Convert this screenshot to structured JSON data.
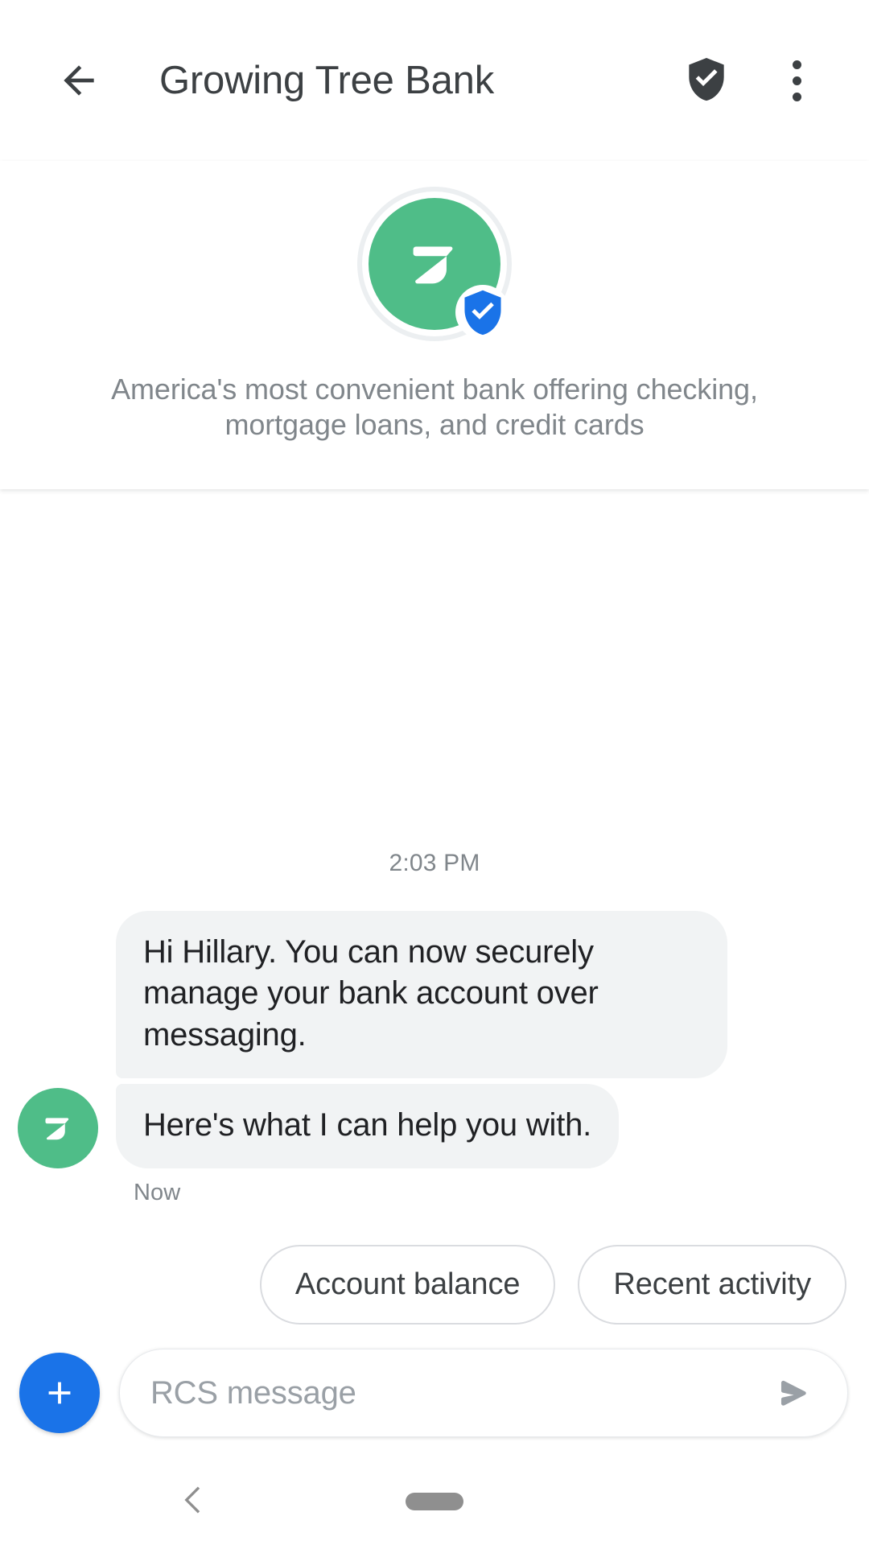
{
  "appbar": {
    "back_icon": "arrow-back-icon",
    "title": "Growing Tree Bank",
    "verified_icon": "verified-shield-icon",
    "overflow_icon": "more-vert-icon"
  },
  "business_header": {
    "avatar_icon": "growing-tree-bank-leaf-logo",
    "avatar_color": "#4fbd88",
    "verified_badge_icon": "verified-shield-badge-icon",
    "verified_badge_color": "#1a73e8",
    "description": "America's most convenient bank offering checking, mortgage loans, and credit cards"
  },
  "conversation": {
    "daystamp": "2:03 PM",
    "messages": [
      {
        "text": "Hi Hillary. You can now securely manage your bank account over messaging.",
        "sender": "business"
      },
      {
        "text": "Here's what I can help you with.",
        "sender": "business"
      }
    ],
    "sent_status": "Now",
    "bubble_color": "#f1f3f4",
    "bubble_text_color": "#202124"
  },
  "suggestions": {
    "chips": [
      {
        "label": "Account balance"
      },
      {
        "label": "Recent activity"
      }
    ]
  },
  "composer": {
    "attach_icon": "plus-icon",
    "attach_color": "#1a73e8",
    "input_value": "",
    "input_placeholder": "RCS message",
    "send_icon": "send-icon"
  },
  "navbar": {
    "back_icon": "nav-back-chevron-icon",
    "home_icon": "nav-home-pill-icon"
  }
}
